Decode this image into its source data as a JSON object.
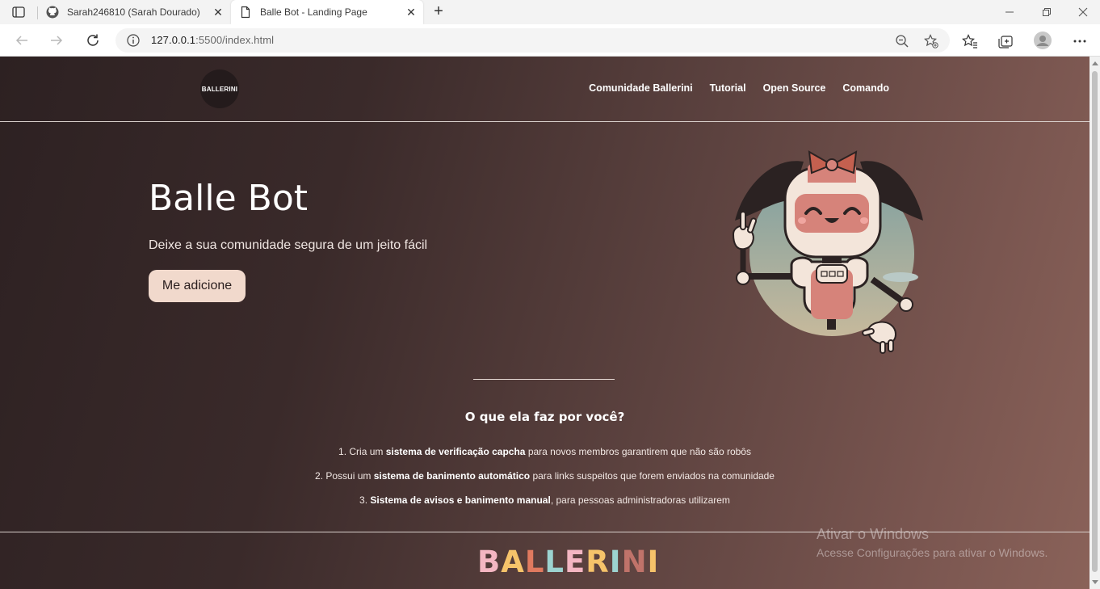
{
  "browser": {
    "tabs": [
      {
        "title": "Sarah246810 (Sarah Dourado)",
        "active": false,
        "icon": "github-icon"
      },
      {
        "title": "Balle Bot - Landing Page",
        "active": true,
        "icon": "page-icon"
      }
    ],
    "url_host": "127.0.0.1",
    "url_path": ":5500/index.html"
  },
  "site": {
    "logo_text": "BALLERINI",
    "nav": [
      "Comunidade Ballerini",
      "Tutorial",
      "Open Source",
      "Comando"
    ],
    "hero": {
      "title": "Balle Bot",
      "subtitle": "Deixe a sua comunidade segura de um jeito fácil",
      "cta": "Me adicione"
    },
    "features_title": "O que ela faz por você?",
    "features": [
      {
        "num": "1.",
        "pre": "Cria um ",
        "bold": "sistema de verificação capcha",
        "post": " para novos membros garantirem que não são robôs"
      },
      {
        "num": "2.",
        "pre": "Possui um ",
        "bold": "sistema de banimento automático",
        "post": " para links suspeitos que forem enviados na comunidade"
      },
      {
        "num": "3.",
        "pre": "",
        "bold": "Sistema de avisos e banimento manual",
        "post": ", para pessoas administradoras utilizarem"
      }
    ],
    "footer_logo_letters": [
      "B",
      "A",
      "L",
      "L",
      "E",
      "R",
      "I",
      "N",
      "I"
    ],
    "footer_logo_colors": [
      "#f4b6c2",
      "#f6c36a",
      "#e07a5f",
      "#9cd3d0",
      "#f4b6c2",
      "#f6c36a",
      "#9cd3d0",
      "#c0736a",
      "#f6c36a"
    ]
  },
  "windows_watermark": {
    "line1": "Ativar o Windows",
    "line2": "Acesse Configurações para ativar o Windows."
  }
}
